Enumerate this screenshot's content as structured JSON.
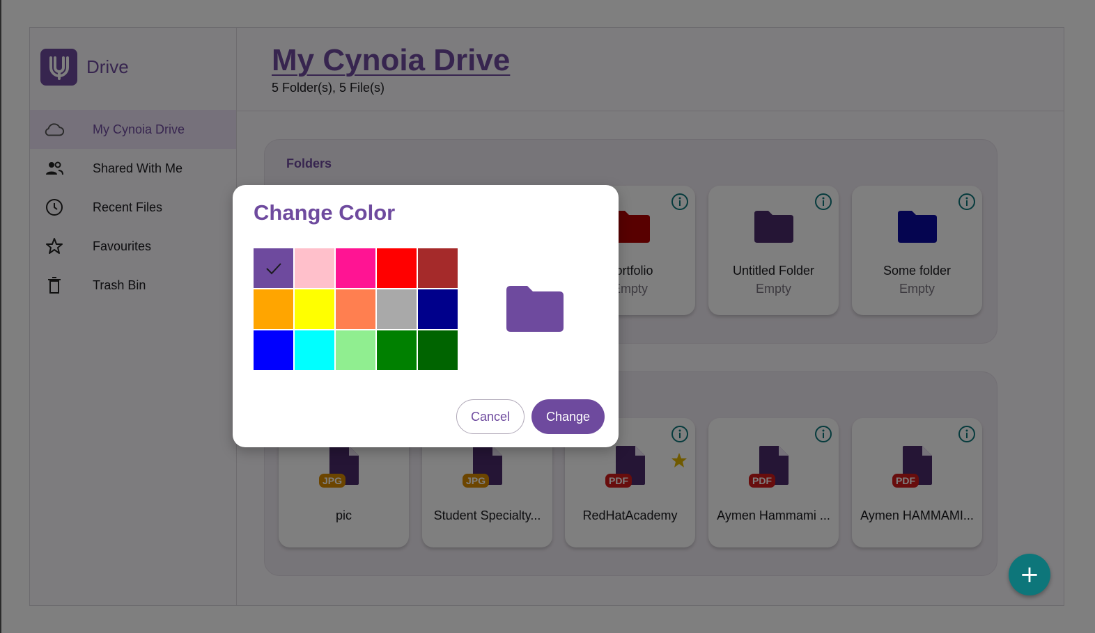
{
  "brand": {
    "name": "Drive"
  },
  "nav": [
    {
      "label": "My Cynoia Drive",
      "icon": "cloud-icon",
      "active": true
    },
    {
      "label": "Shared With Me",
      "icon": "people-icon"
    },
    {
      "label": "Recent Files",
      "icon": "clock-icon"
    },
    {
      "label": "Favourites",
      "icon": "star-outline-icon"
    },
    {
      "label": "Trash Bin",
      "icon": "trash-icon"
    }
  ],
  "header": {
    "title": "My Cynoia Drive",
    "subtitle": "5 Folder(s), 5 File(s)"
  },
  "folders_section": {
    "title": "Folders",
    "items": [
      {
        "name": "Portfolio",
        "status": "Empty",
        "color": "#b00000"
      },
      {
        "name": "Untitled Folder",
        "status": "Empty",
        "color": "#4b2a6b"
      },
      {
        "name": "Some folder",
        "status": "Empty",
        "color": "#0a0aa0"
      }
    ]
  },
  "files_section": {
    "items": [
      {
        "name": "pic",
        "type": "JPG",
        "favourite": false
      },
      {
        "name": "Student Specialty...",
        "type": "JPG",
        "favourite": false
      },
      {
        "name": "RedHatAcademy",
        "type": "PDF",
        "favourite": true
      },
      {
        "name": "Aymen Hammami ...",
        "type": "PDF",
        "favourite": false
      },
      {
        "name": "Aymen HAMMAMI...",
        "type": "PDF",
        "favourite": false
      }
    ]
  },
  "dialog": {
    "title": "Change Color",
    "selected_color": "#6e4a9e",
    "palette": [
      "#6e4a9e",
      "#ffc0cb",
      "#ff1493",
      "#ff0000",
      "#a52a2a",
      "#ffa500",
      "#ffff00",
      "#ff7f50",
      "#a9a9a9",
      "#00008b",
      "#0000ff",
      "#00ffff",
      "#90ee90",
      "#008000",
      "#006400"
    ],
    "cancel_label": "Cancel",
    "change_label": "Change"
  },
  "fab": {
    "glyph": "+"
  },
  "colors": {
    "accent": "#6e4a9e",
    "teal": "#0d767a",
    "folder_default": "#4b2a6b",
    "file_icon": "#4b2a6b"
  }
}
